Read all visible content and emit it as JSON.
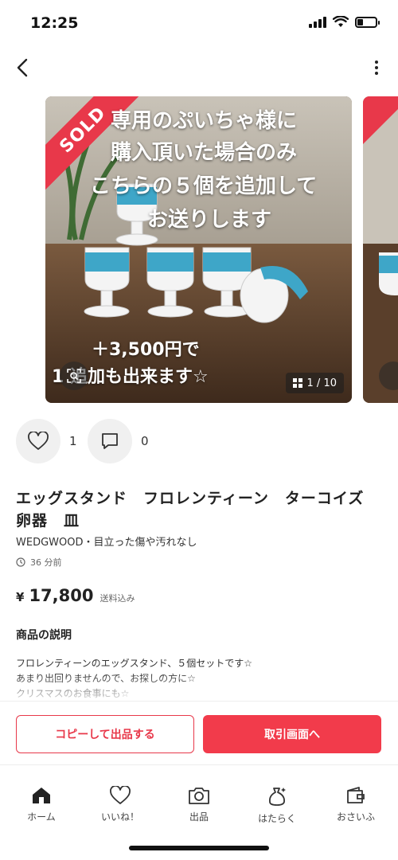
{
  "status_bar": {
    "time": "12:25"
  },
  "photo": {
    "sold_label": "SOLD",
    "overlay_lines": [
      "専用のぷいちゃ様に",
      "購入頂いた場合のみ",
      "こちらの５個を追加して",
      "お送りします"
    ],
    "bottom_line1": "＋3,500円で",
    "bottom_line2": "1  追加も出来ます☆",
    "counter": "1 / 10"
  },
  "reactions": {
    "likes": "1",
    "comments": "0"
  },
  "item": {
    "title": "エッグスタンド　フロレンティーン　ターコイズ　卵器　皿",
    "brand_condition": "WEDGWOOD・目立った傷や汚れなし",
    "posted": "36 分前",
    "price_symbol": "¥",
    "price": "17,800",
    "shipping": "送料込み"
  },
  "description": {
    "heading": "商品の説明",
    "body": "フロレンティーンのエッグスタンド、５個セットです☆\nあまり出回りませんので、お探しの方に☆\nクリスマスのお食事にも☆"
  },
  "actions": {
    "copy_label": "コピーして出品する",
    "trade_label": "取引画面へ"
  },
  "tabs": [
    {
      "label": "ホーム",
      "icon": "home-icon"
    },
    {
      "label": "いいね！",
      "icon": "heart-icon"
    },
    {
      "label": "出品",
      "icon": "camera-icon"
    },
    {
      "label": "はたらく",
      "icon": "money-bag-icon"
    },
    {
      "label": "おさいふ",
      "icon": "wallet-icon"
    }
  ],
  "colors": {
    "accent": "#f23b4b",
    "sold_ribbon": "#e8384a"
  }
}
